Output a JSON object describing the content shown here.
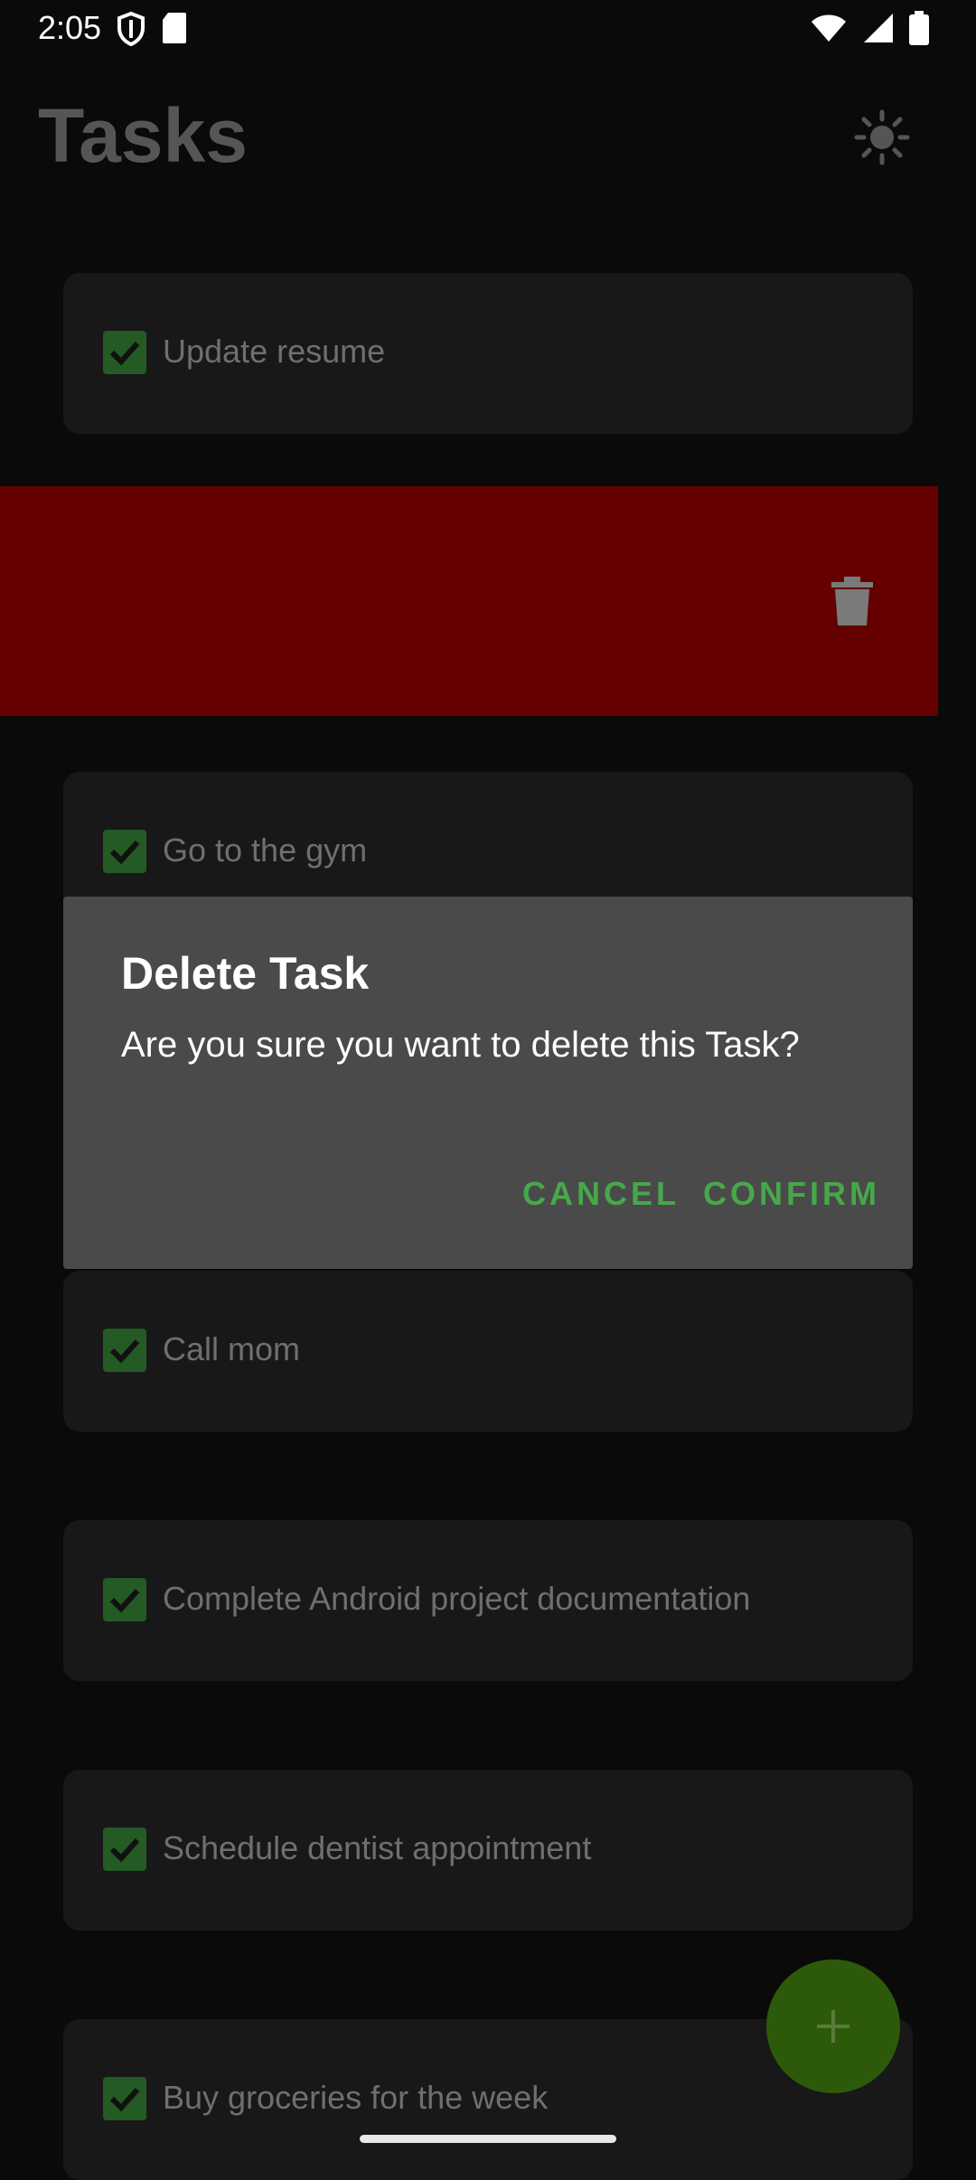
{
  "status_bar": {
    "time": "2:05"
  },
  "app_bar": {
    "title": "Tasks",
    "theme_icon": "sun-icon"
  },
  "tasks": [
    {
      "label": "Update resume",
      "checked": true
    },
    {
      "label": "Go to the gym",
      "checked": true
    },
    {
      "label": "Call mom",
      "checked": true
    },
    {
      "label": "Complete Android project documentation",
      "checked": true
    },
    {
      "label": "Schedule dentist appointment",
      "checked": true
    },
    {
      "label": "Buy groceries for the week",
      "checked": true
    }
  ],
  "swipe": {
    "icon": "trash-icon",
    "color": "#640000"
  },
  "dialog": {
    "title": "Delete Task",
    "message": "Are you sure you want to delete this Task?",
    "cancel_label": "CANCEL",
    "confirm_label": "CONFIRM",
    "accent": "#47a84a"
  },
  "fab": {
    "icon": "plus-icon"
  }
}
